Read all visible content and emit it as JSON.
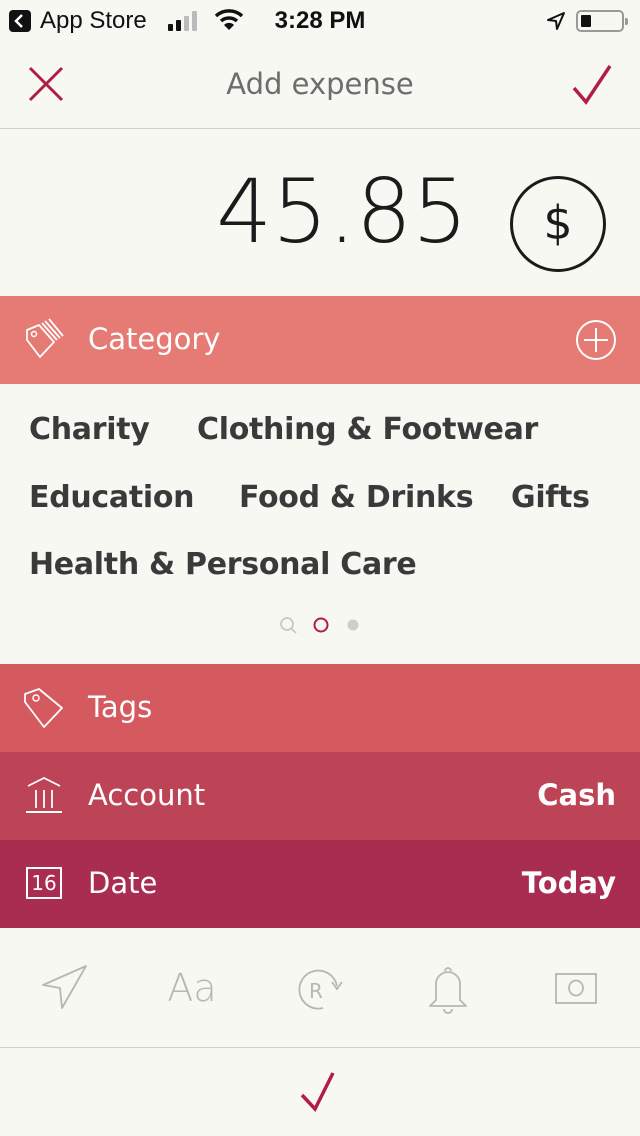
{
  "status_bar": {
    "back_app": "App Store",
    "time": "3:28 PM",
    "signal_bars": 2,
    "battery_level": 0.2
  },
  "nav": {
    "title": "Add expense",
    "close_icon": "close-icon",
    "confirm_icon": "checkmark-icon"
  },
  "amount": {
    "value": "45.85",
    "currency_symbol": "$"
  },
  "category": {
    "label": "Category",
    "add_icon": "plus-circle-icon",
    "items": [
      "Charity",
      "Clothing & Footwear",
      "Education",
      "Food & Drinks",
      "Gifts",
      "Health & Personal Care"
    ],
    "pager": {
      "pages": 3,
      "current": 2,
      "first_is_search": true
    }
  },
  "rows": {
    "tags": {
      "label": "Tags",
      "value": ""
    },
    "account": {
      "label": "Account",
      "value": "Cash"
    },
    "date": {
      "label": "Date",
      "value": "Today",
      "icon_day": "16"
    }
  },
  "toolbar": {
    "items": [
      "location-icon",
      "note-text-icon",
      "recurring-icon",
      "reminder-bell-icon",
      "photo-icon"
    ],
    "text_icon_label": "Aa"
  },
  "colors": {
    "accent": "#b01e44",
    "category_header": "#e57b74",
    "tags_row": "#d45a5f",
    "account_row": "#bd4357",
    "date_row": "#a82d50",
    "background": "#f8f8f3"
  }
}
